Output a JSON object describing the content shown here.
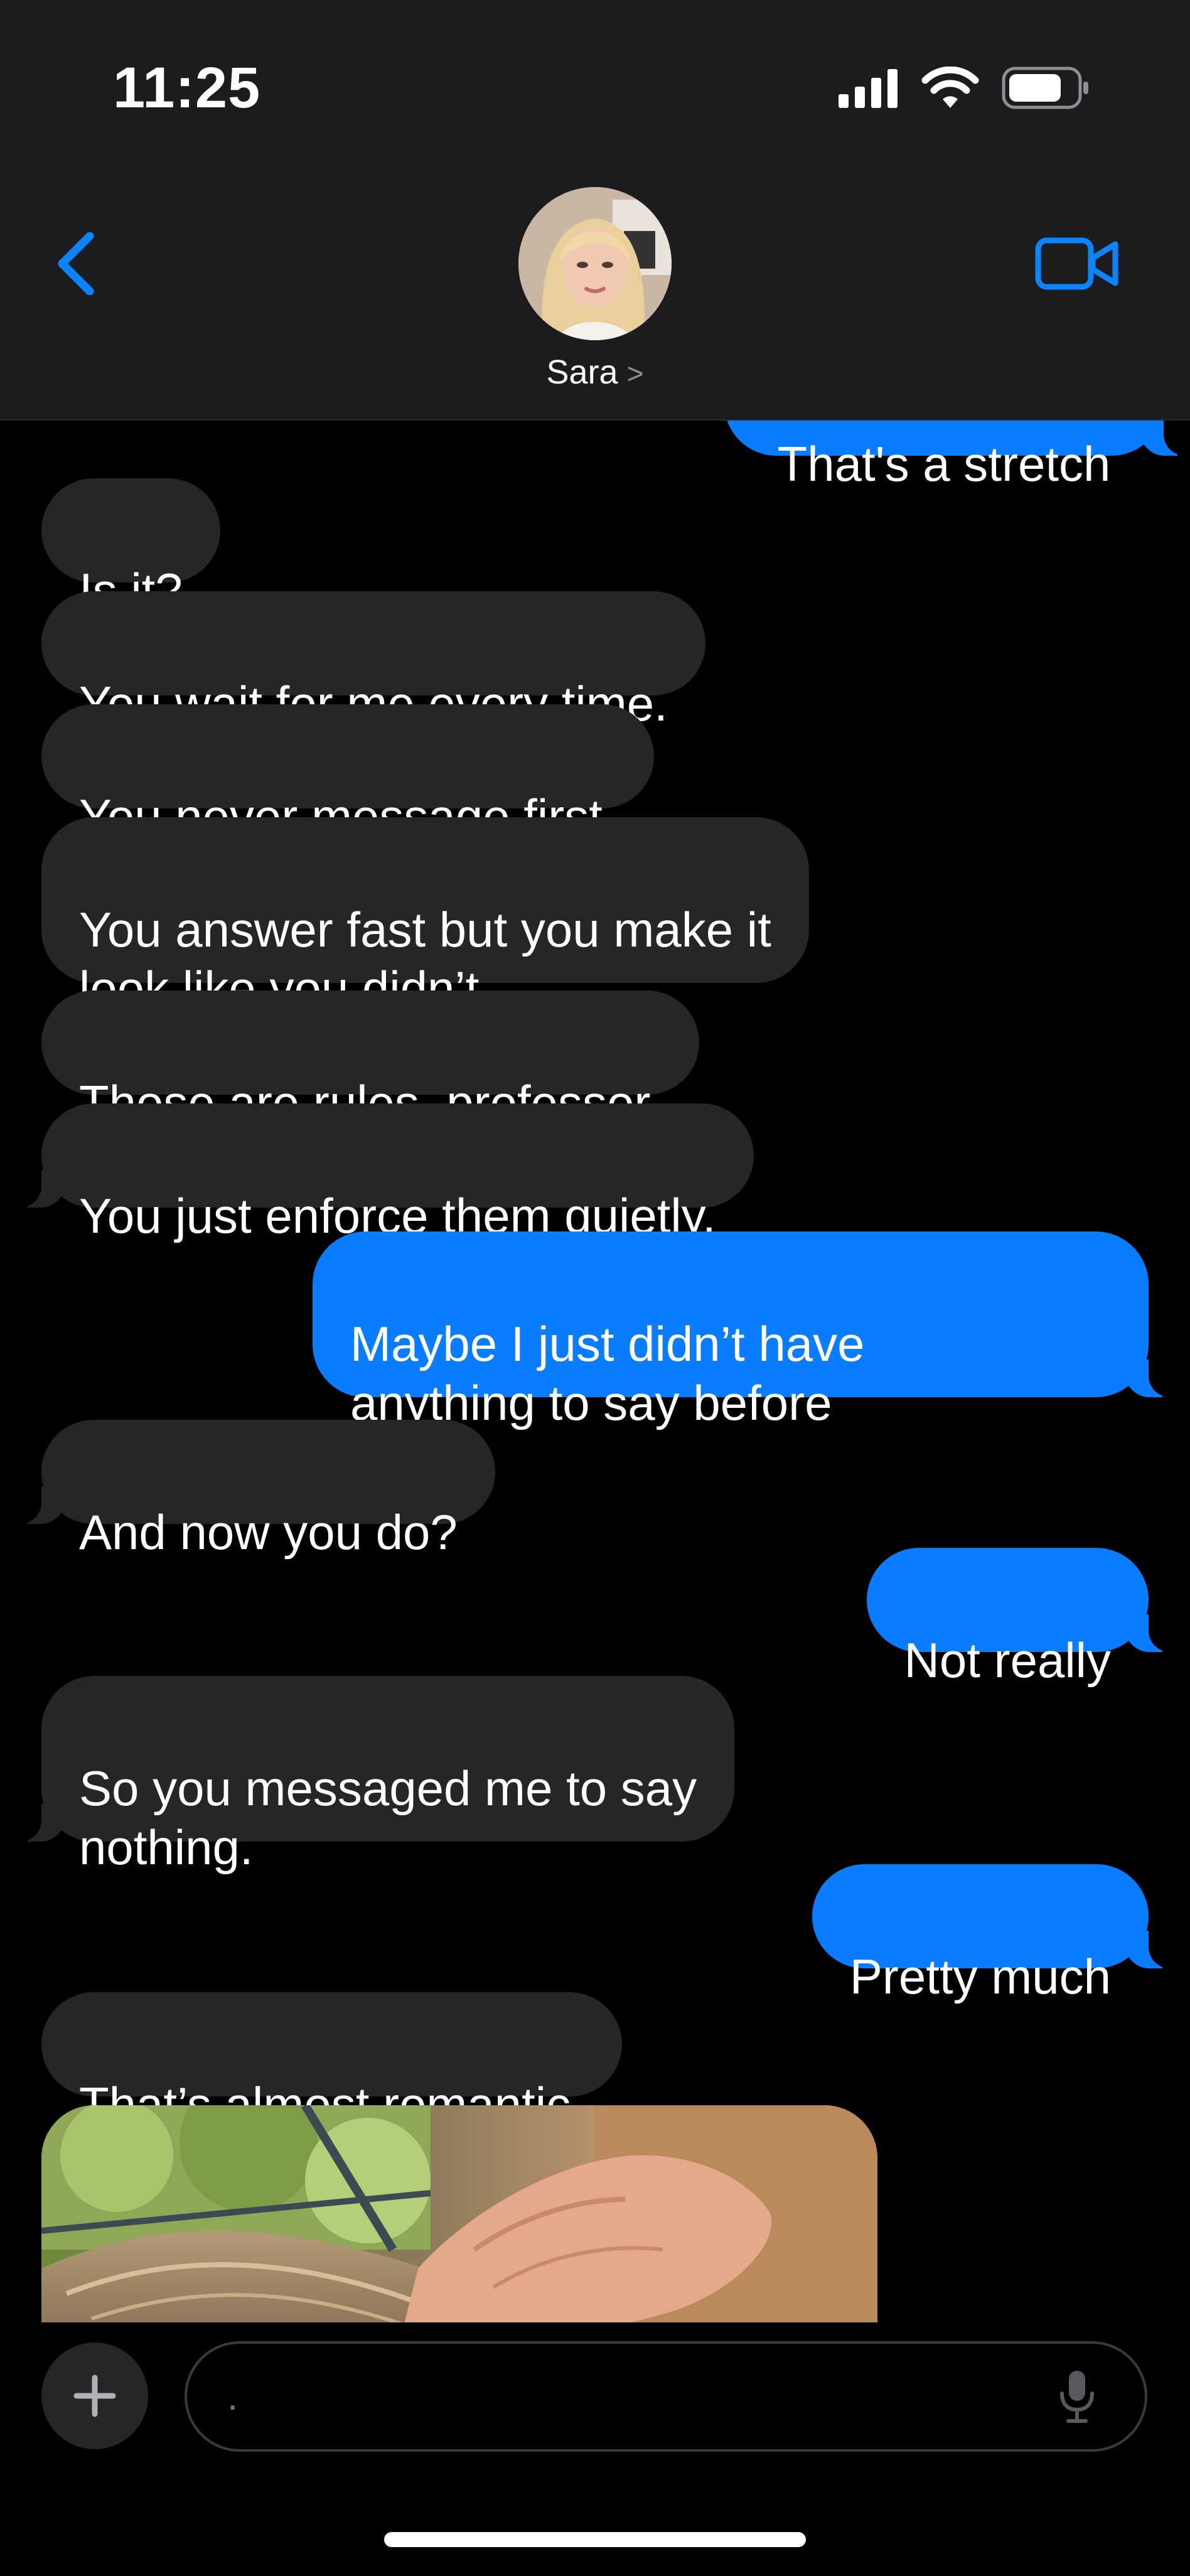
{
  "status_bar": {
    "time": "11:25",
    "icons": [
      "signal-icon",
      "wifi-icon",
      "battery-icon"
    ]
  },
  "header": {
    "back_icon": "chevron-left-icon",
    "contact_name": "Sara",
    "name_chevron": ">",
    "video_icon": "video-camera-icon"
  },
  "messages": [
    {
      "sender": "me",
      "text": "That's a stretch"
    },
    {
      "sender": "them",
      "text": "Is it?"
    },
    {
      "sender": "them",
      "text": "You wait for me every time."
    },
    {
      "sender": "them",
      "text": "You never message first."
    },
    {
      "sender": "them",
      "text": "You answer fast but you make it\nlook like you didn’t."
    },
    {
      "sender": "them",
      "text": "Those are rules, professor."
    },
    {
      "sender": "them",
      "text": "You just enforce them quietly."
    },
    {
      "sender": "me",
      "text": "Maybe I just didn’t have\nanything to say before"
    },
    {
      "sender": "them",
      "text": "And now you do?"
    },
    {
      "sender": "me",
      "text": "Not really"
    },
    {
      "sender": "them",
      "text": "So you messaged me to say\nnothing."
    },
    {
      "sender": "me",
      "text": "Pretty much"
    },
    {
      "sender": "them",
      "text": "That’s almost romantic."
    },
    {
      "sender": "them",
      "type": "photo",
      "icon": "photo-attachment"
    }
  ],
  "composer": {
    "plus_icon": "plus-icon",
    "placeholder": ".",
    "mic_icon": "microphone-icon"
  },
  "colors": {
    "outgoing_bubble": "#0a7cff",
    "incoming_bubble": "#262628",
    "accent": "#0a84ff",
    "header_bg": "#1c1c1e",
    "background": "#000000"
  }
}
